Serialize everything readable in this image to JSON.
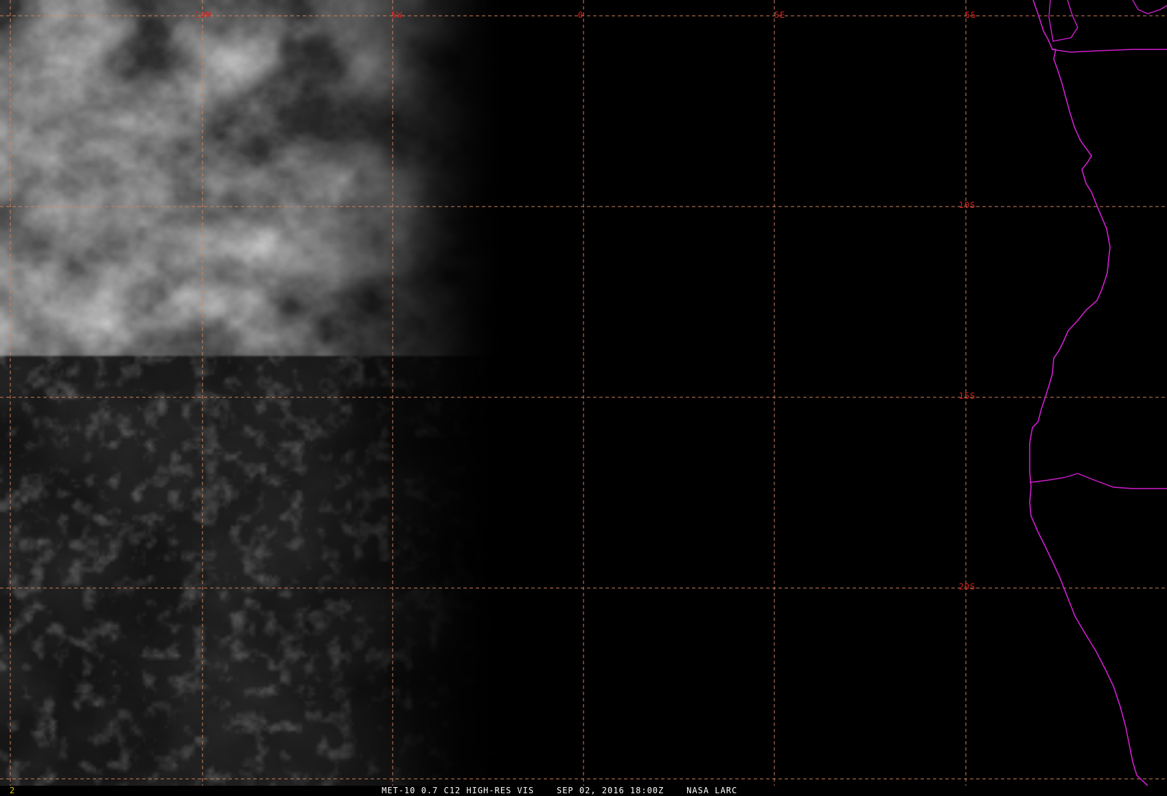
{
  "map": {
    "grid_color": "#d2825a",
    "label_color": "#e01e1e",
    "border_color": "#d21ed2",
    "longitude_labels": [
      "10W",
      "5W",
      "0",
      "5E"
    ],
    "latitude_labels": [
      "5S",
      "10S",
      "15S",
      "20S"
    ]
  },
  "status_bar": {
    "frame_number": "2",
    "satellite": "MET-10 0.7 C12 HIGH-RES VIS",
    "datetime": "SEP 02, 2016 18:00Z",
    "source": "NASA LARC"
  }
}
